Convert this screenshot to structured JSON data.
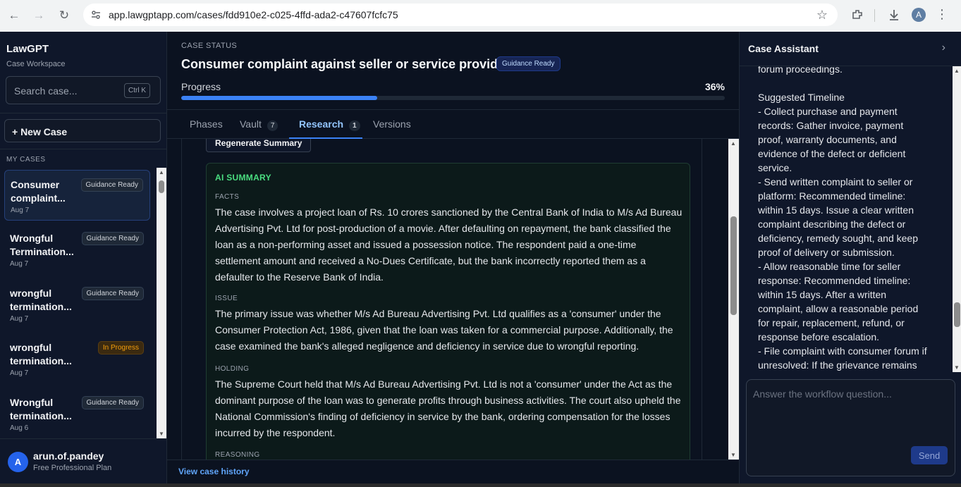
{
  "browser": {
    "url": "app.lawgptapp.com/cases/fdd910e2-c025-4ffd-ada2-c47607fcfc75",
    "profile_initial": "A"
  },
  "sidebar": {
    "brand": "LawGPT",
    "subtitle": "Case Workspace",
    "search_placeholder": "Search case...",
    "search_shortcut": "Ctrl K",
    "new_case_label": "+ New Case",
    "section_label": "MY CASES",
    "cases": [
      {
        "title": "Consumer complaint...",
        "date": "Aug 7",
        "status": "Guidance Ready",
        "active": true
      },
      {
        "title": "Wrongful Termination...",
        "date": "Aug 7",
        "status": "Guidance Ready",
        "active": false
      },
      {
        "title": "wrongful termination...",
        "date": "Aug 7",
        "status": "Guidance Ready",
        "active": false
      },
      {
        "title": "wrongful termination...",
        "date": "Aug 7",
        "status": "In Progress",
        "active": false
      },
      {
        "title": "Wrongful termination...",
        "date": "Aug 6",
        "status": "Guidance Ready",
        "active": false
      }
    ],
    "user": {
      "initial": "A",
      "name": "arun.of.pandey",
      "plan": "Free Professional Plan"
    }
  },
  "main": {
    "status_label": "CASE STATUS",
    "title": "Consumer complaint against seller or service provider",
    "badge": "Guidance Ready",
    "progress_label": "Progress",
    "progress_text": "36%",
    "progress_value": 36,
    "tabs": [
      {
        "label": "Phases",
        "count": ""
      },
      {
        "label": "Vault",
        "count": "7"
      },
      {
        "label": "Research",
        "count": "1"
      },
      {
        "label": "Versions",
        "count": ""
      }
    ],
    "regenerate_label": "Regenerate Summary",
    "summary": {
      "title": "AI SUMMARY",
      "facts_label": "FACTS",
      "facts": "The case involves a project loan of Rs. 10 crores sanctioned by the Central Bank of India to M/s Ad Bureau Advertising Pvt. Ltd for post-production of a movie. After defaulting on repayment, the bank classified the loan as a non-performing asset and issued a possession notice. The respondent paid a one-time settlement amount and received a No-Dues Certificate, but the bank incorrectly reported them as a defaulter to the Reserve Bank of India.",
      "issue_label": "ISSUE",
      "issue": "The primary issue was whether M/s Ad Bureau Advertising Pvt. Ltd qualifies as a 'consumer' under the Consumer Protection Act, 1986, given that the loan was taken for a commercial purpose. Additionally, the case examined the bank's alleged negligence and deficiency in service due to wrongful reporting.",
      "holding_label": "HOLDING",
      "holding": "The Supreme Court held that M/s Ad Bureau Advertising Pvt. Ltd is not a 'consumer' under the Act as the dominant purpose of the loan was to generate profits through business activities. The court also upheld the National Commission's finding of deficiency in service by the bank, ordering compensation for the losses incurred by the respondent.",
      "reasoning_label": "REASONING"
    },
    "history_link": "View case history"
  },
  "assistant": {
    "title": "Case Assistant",
    "message": "g... ... g...\nforum proceedings.\n\nSuggested Timeline\n- Collect purchase and payment records: Gather invoice, payment proof, warranty documents, and evidence of the defect or deficient service.\n- Send written complaint to seller or platform: Recommended timeline: within 15 days. Issue a clear written complaint describing the defect or deficiency, remedy sought, and keep proof of delivery or submission.\n- Allow reasonable time for seller response: Recommended timeline: within 15 days. After a written complaint, allow a reasonable period for repair, replacement, refund, or response before escalation.\n- File complaint with consumer forum if unresolved: If the grievance remains",
    "input_placeholder": "Answer the workflow question...",
    "send_label": "Send"
  }
}
